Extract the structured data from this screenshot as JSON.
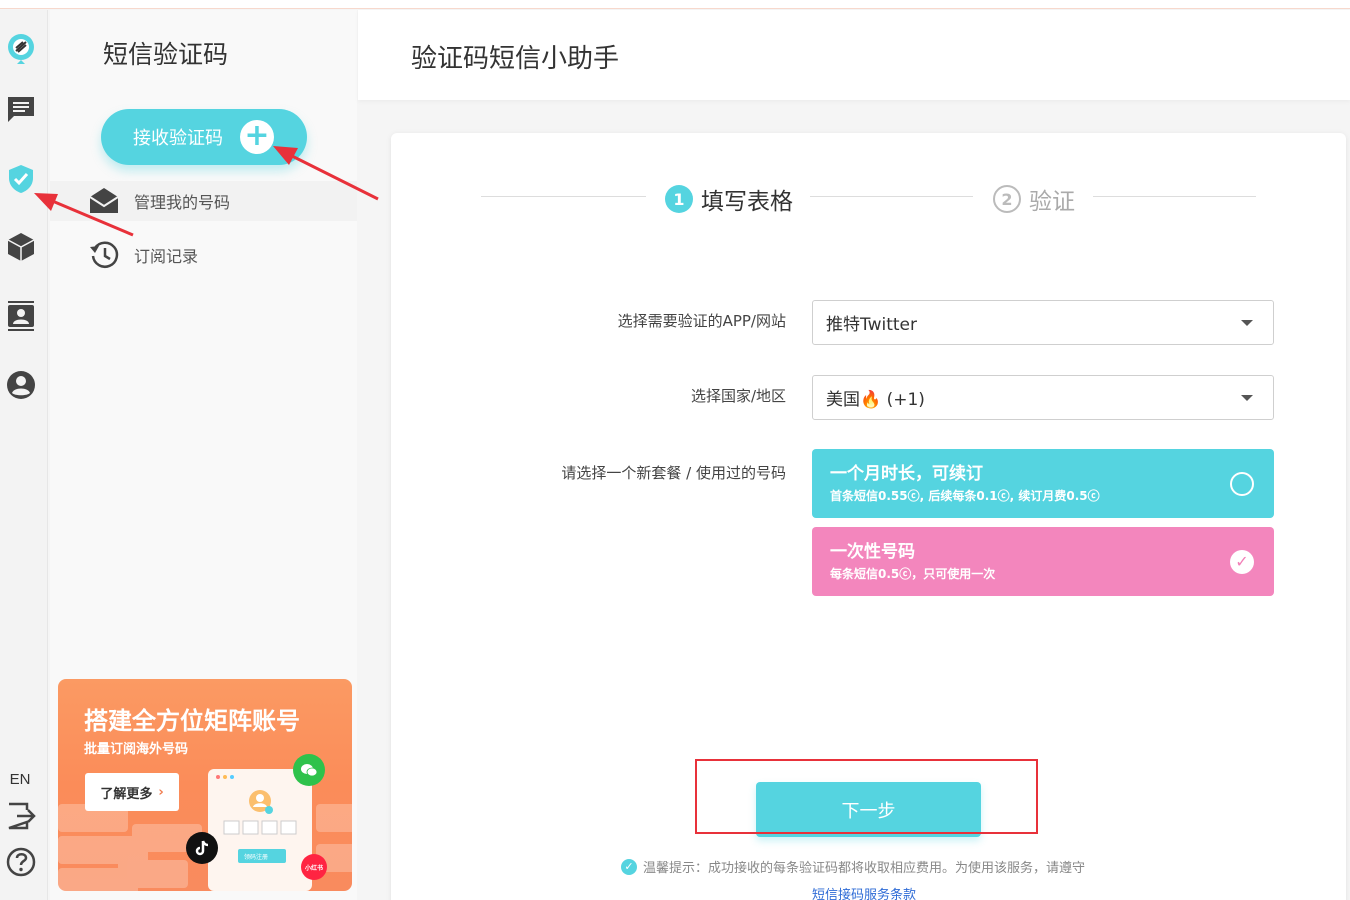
{
  "rail": {
    "lang": "EN"
  },
  "sidebar": {
    "title": "短信验证码",
    "receive_button": "接收验证码",
    "items": [
      {
        "label": "管理我的号码"
      },
      {
        "label": "订阅记录"
      }
    ],
    "promo": {
      "title": "搭建全方位矩阵账号",
      "subtitle": "批量订阅海外号码",
      "button": "了解更多",
      "card_button": "领码注册",
      "redbook": "小红书"
    }
  },
  "header": {
    "title": "验证码短信小助手"
  },
  "steps": [
    {
      "num": "1",
      "label": "填写表格"
    },
    {
      "num": "2",
      "label": "验证"
    }
  ],
  "form": {
    "app_label": "选择需要验证的APP/网站",
    "app_value": "推特Twitter",
    "country_label": "选择国家/地区",
    "country_value": "美国🔥 (+1)",
    "plan_label": "请选择一个新套餐 / 使用过的号码",
    "plans": [
      {
        "title": "一个月时长，可续订",
        "desc": "首条短信0.55ⓒ, 后续每条0.1ⓒ, 续订月费0.5ⓒ",
        "selected": false,
        "color": "#55d4e0"
      },
      {
        "title": "一次性号码",
        "desc": "每条短信0.5ⓒ，只可使用一次",
        "selected": true,
        "color": "#f386bd"
      }
    ],
    "next_button": "下一步",
    "tip": "温馨提示：成功接收的每条验证码都将收取相应费用。为使用该服务，请遵守",
    "terms_link": "短信接码服务条款"
  },
  "colors": {
    "accent": "#55d4e0",
    "pink": "#f386bd",
    "promo": "#fb8c59",
    "annotation_red": "#e8313a"
  }
}
